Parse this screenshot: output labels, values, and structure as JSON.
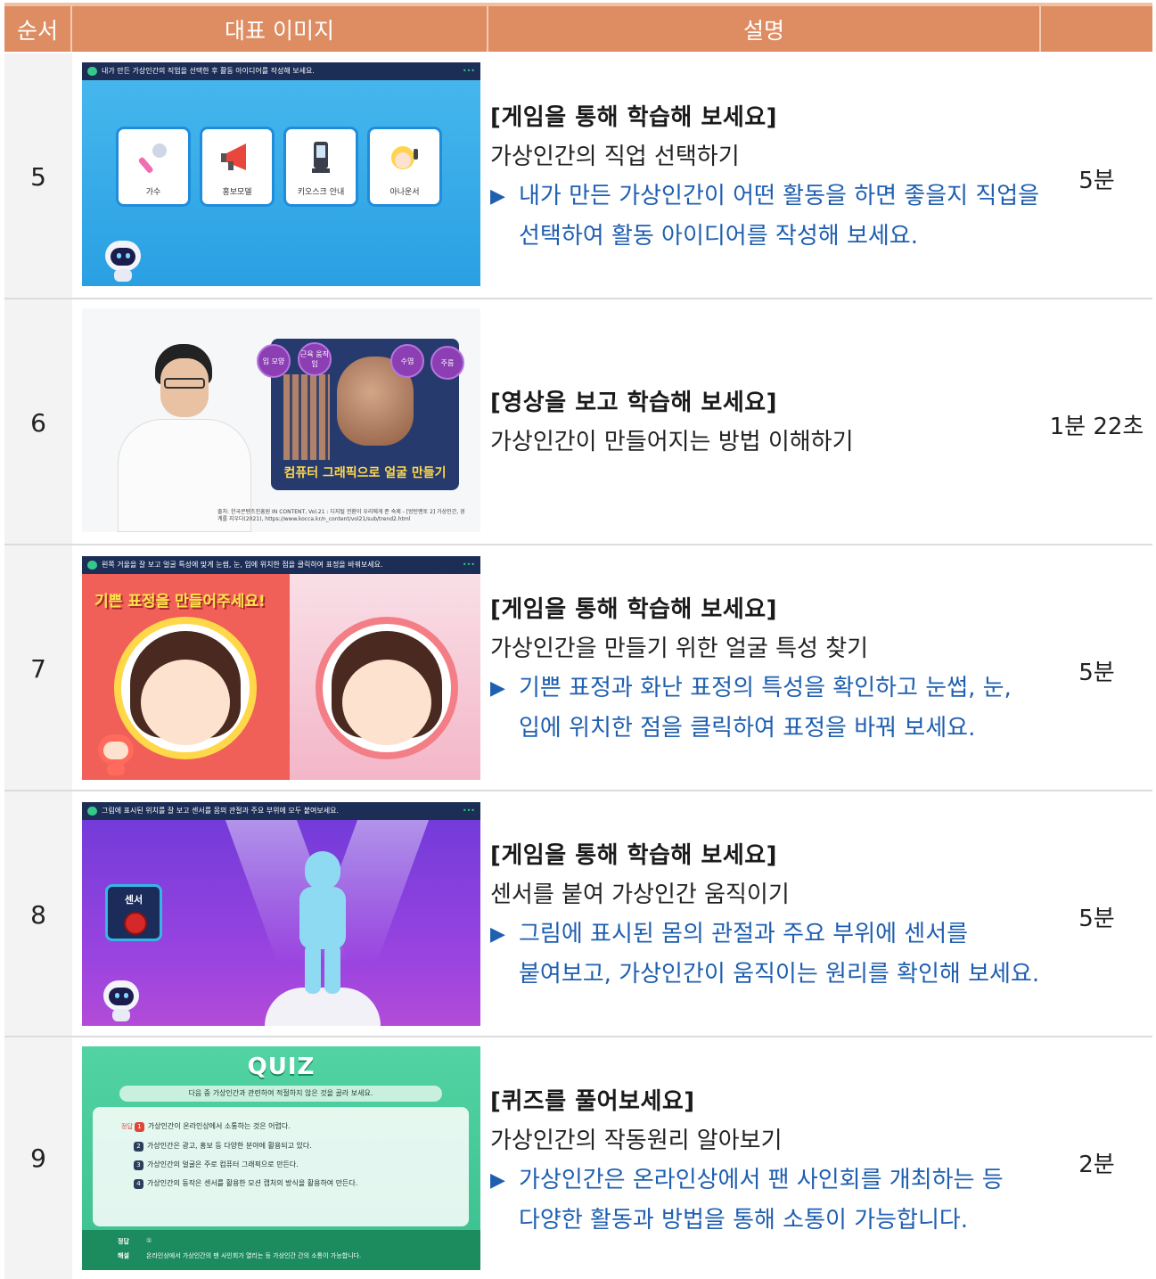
{
  "header": {
    "order": "순서",
    "image": "대표 이미지",
    "description": "설명",
    "time": ""
  },
  "rows": [
    {
      "order": "5",
      "title": "[게임을 통해 학습해 보세요]",
      "subtitle": "가상인간의 직업 선택하기",
      "note_lines": [
        "내가 만든 가상인간이 어떤 활동을 하면 좋을지 직업을",
        "선택하여 활동 아이디어를 작성해 보세요."
      ],
      "time": "5분",
      "thumb": {
        "bar_text": "내가 만든 가상인간의 직업을 선택한 후 활동 아이디어를 작성해 보세요.",
        "cards": [
          "가수",
          "홍보모델",
          "키오스크 안내",
          "아나운서"
        ]
      }
    },
    {
      "order": "6",
      "title": "[영상을 보고 학습해 보세요]",
      "subtitle": "가상인간이 만들어지는 방법 이해하기",
      "note_lines": [],
      "time": "1분 22초",
      "thumb": {
        "bubbles": [
          "입 모양",
          "근육 움직임",
          "수염",
          "주름"
        ],
        "caption": "컴퓨터 그래픽으로 얼굴 만들기",
        "source": "출처: 한국콘텐츠진흥원 IN CONTENT, Vol.21 : 디지털 전환이 우리에게 준 숙제 - [방탄멘토 2] 가상인간, 경계를 지우다(2021), https://www.kocca.kr/n_content/vol21/sub/trend2.html"
      }
    },
    {
      "order": "7",
      "title": "[게임을 통해 학습해 보세요]",
      "subtitle": "가상인간을 만들기 위한 얼굴 특성 찾기",
      "note_lines": [
        "기쁜 표정과 화난 표정의 특성을 확인하고 눈썹, 눈,",
        "입에 위치한 점을 클릭하여 표정을 바꿔 보세요."
      ],
      "time": "5분",
      "thumb": {
        "bar_text": "왼쪽 거울을 잘 보고 얼굴 특성에 맞게 눈썹, 눈, 입에 위치한 점을 클릭하여 표정을 바꿔보세요.",
        "banner": "기쁜 표정을 만들어주세요!"
      }
    },
    {
      "order": "8",
      "title": "[게임을 통해 학습해 보세요]",
      "subtitle": "센서를 붙여 가상인간 움직이기",
      "note_lines": [
        "그림에 표시된 몸의 관절과 주요 부위에 센서를",
        "붙여보고, 가상인간이 움직이는 원리를 확인해 보세요."
      ],
      "time": "5분",
      "thumb": {
        "bar_text": "그림에 표시된 위치를 잘 보고 센서를 몸의 관절과 주요 부위에 모두 붙여보세요.",
        "sensor_label": "센서"
      }
    },
    {
      "order": "9",
      "title": "[퀴즈를 풀어보세요]",
      "subtitle": "가상인간의 작동원리 알아보기",
      "note_lines": [
        "가상인간은 온라인상에서 팬 사인회를 개최하는 등",
        "다양한 활동과 방법을 통해 소통이 가능합니다."
      ],
      "time": "2분",
      "thumb": {
        "quiz_title": "QUIZ",
        "question": "다음 중 가상인간과 관련하여 적절하지 않은 것을 골라 보세요.",
        "answer_tag": "정답",
        "options": [
          {
            "num": "1",
            "text": "가상인간이 온라인상에서 소통하는 것은 어렵다."
          },
          {
            "num": "2",
            "text": "가상인간은 광고, 홍보 등 다양한 분야에 활용되고 있다."
          },
          {
            "num": "3",
            "text": "가상인간의 얼굴은 주로 컴퓨터 그래픽으로 만든다."
          },
          {
            "num": "4",
            "text": "가상인간의 동작은 센서를 활용한 모션 캡처의 방식을 활용하여 만든다."
          }
        ],
        "answer_label": "정답",
        "answer_value": "①",
        "explain_label": "해설",
        "explain_text": "온라인상에서 가상인간의 팬 사인회가 열리는 등 가상인간 간의 소통이 가능합니다."
      }
    }
  ],
  "colors": {
    "header_bg": "#de8c62",
    "note_blue": "#1f5fb0",
    "order_bg": "#f3f3f3"
  }
}
